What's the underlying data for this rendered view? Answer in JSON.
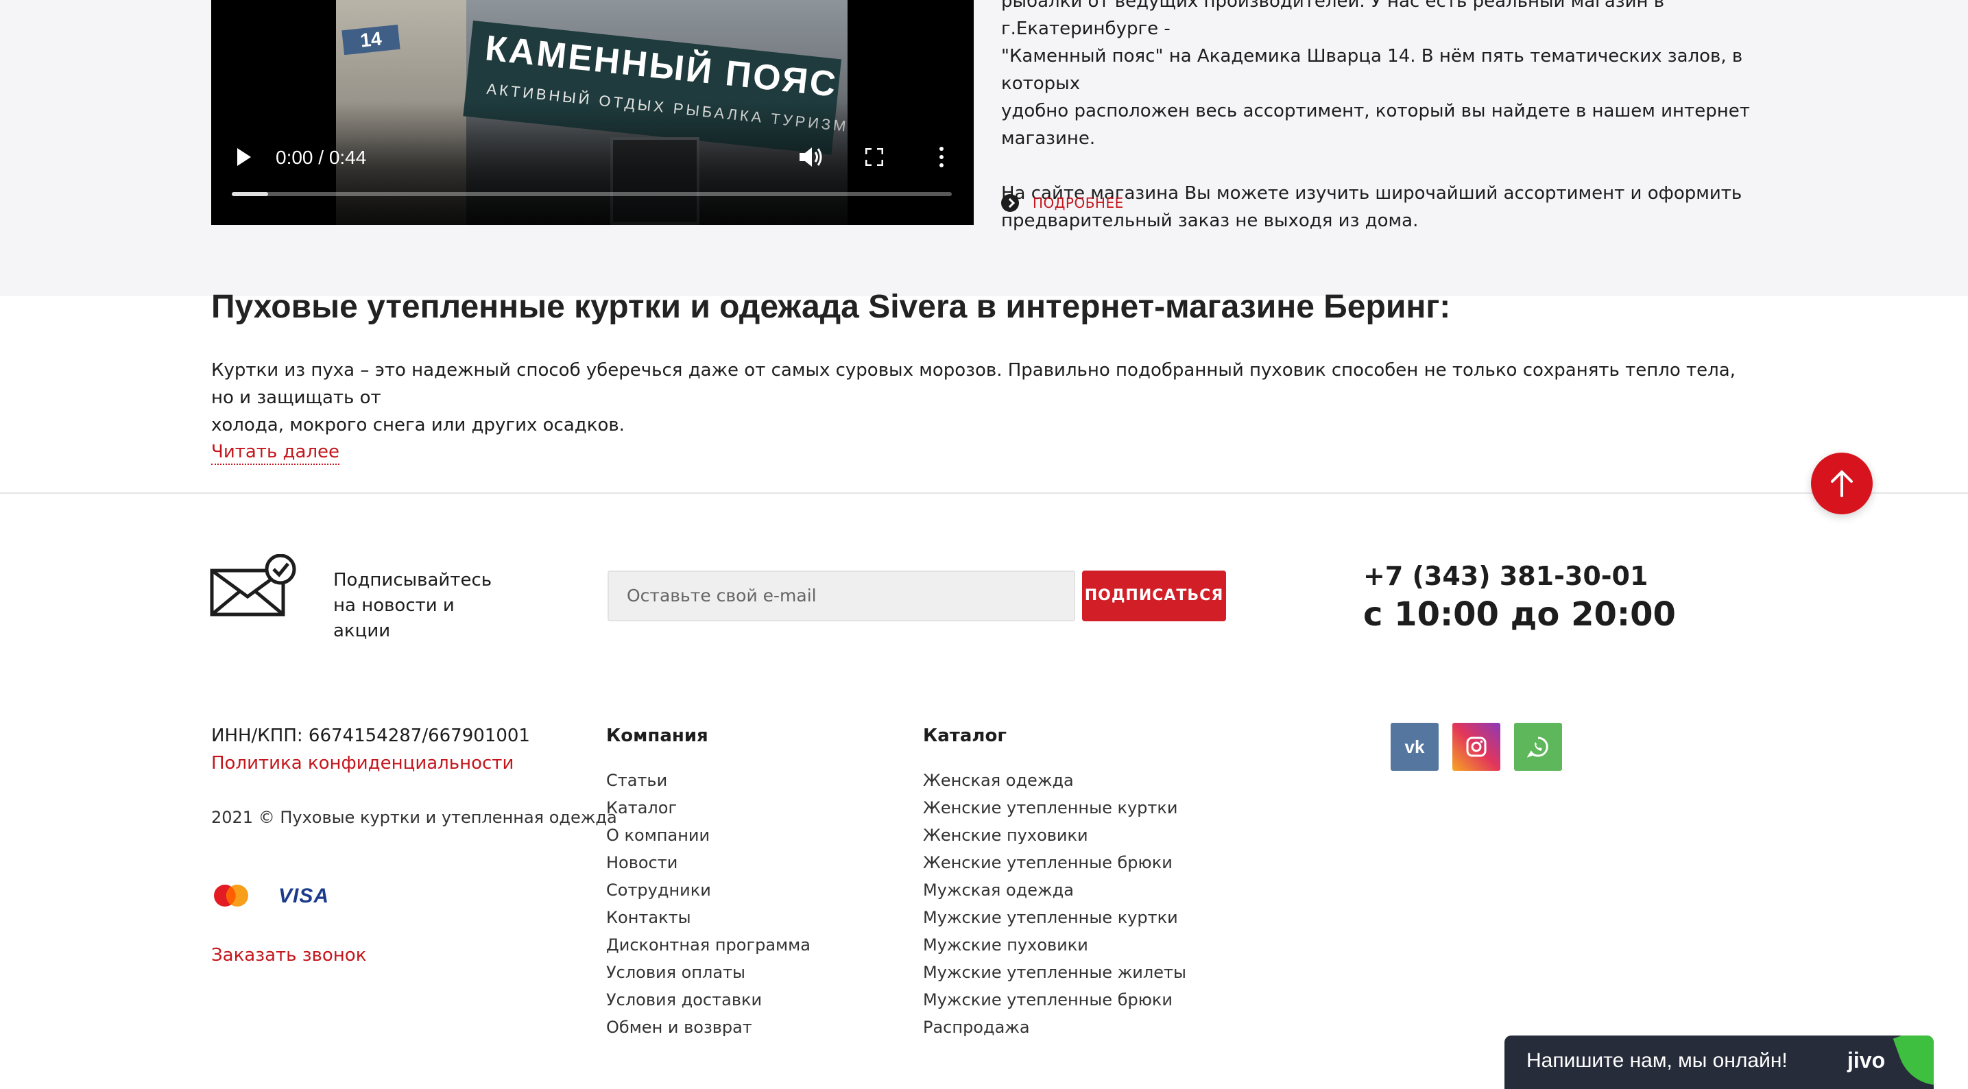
{
  "about": {
    "paragraph1_line1": "рыбалки от ведущих производителей. У нас есть реальный магазин в г.Екатеринбурге -",
    "paragraph1_line2": "\"Каменный пояс\" на Академика Шварца 14. В нём пять тематических залов, в которых",
    "paragraph1_line3": "удобно расположен весь ассортимент, который вы найдете в нашем интернет магазине.",
    "paragraph2_line1": "На сайте магазина Вы можете изучить широчайший ассортимент и оформить",
    "paragraph2_line2": "предварительный заказ не выходя из дома.",
    "more_label": "ПОДРОБНЕЕ"
  },
  "video": {
    "time": "0:00 / 0:44",
    "progress_fraction": 0.05,
    "still": {
      "building_number": "14",
      "sign_title": "КАМЕННЫЙ ПОЯС",
      "sign_subtitle": "АКТИВНЫЙ ОТДЫХ  РЫБАЛКА  ТУРИЗМ"
    }
  },
  "seo": {
    "title": "Пуховые утепленные куртки и одежада Sivera в интернет-магазине Беринг:",
    "text_line1": "Куртки из пуха – это надежный способ уберечься даже от самых суровых морозов. Правильно подобранный пуховик способен не только сохранять тепло тела, но и защищать от",
    "text_line2": "холода, мокрого снега или других осадков.",
    "read_more": "Читать далее"
  },
  "subscribe": {
    "caption_line1": "Подписывайтесь",
    "caption_line2": "на новости и акции",
    "placeholder": "Оставьте свой e-mail",
    "button_label": "ПОДПИСАТЬСЯ"
  },
  "contacts": {
    "phone": "+7 (343) 381-30-01",
    "hours": "с 10:00 до 20:00"
  },
  "footer": {
    "inn": "ИНН/КПП: 6674154287/667901001",
    "policy": "Политика конфиденциальности",
    "copyright": "2021 © Пуховые куртки и утепленная одежда",
    "visa": "VISA",
    "callback": "Заказать звонок",
    "company_title": "Компания",
    "company_links": [
      "Статьи",
      "Каталог",
      "О компании",
      "Новости",
      "Сотрудники",
      "Контакты",
      "Дисконтная программа",
      "Условия оплаты",
      "Условия доставки",
      "Обмен и возврат"
    ],
    "catalog_title": "Каталог",
    "catalog_links": [
      "Женская одежда",
      "Женские утепленные куртки",
      "Женские пуховики",
      "Женские утепленные брюки",
      "Мужская одежда",
      "Мужские утепленные куртки",
      "Мужские пуховики",
      "Мужские утепленные жилеты",
      "Мужские утепленные брюки",
      "Распродажа"
    ],
    "social": [
      {
        "name": "vk-icon",
        "glyph": "vk"
      },
      {
        "name": "instagram-icon"
      },
      {
        "name": "whatsapp-icon"
      }
    ]
  },
  "chat": {
    "label": "Напишите нам, мы онлайн!",
    "brand": "jivo"
  },
  "colors": {
    "accent_red": "#c4161c",
    "button_red": "#d21f27",
    "gray_bg": "#f5f5f7",
    "chat_bg": "#262c3a"
  }
}
